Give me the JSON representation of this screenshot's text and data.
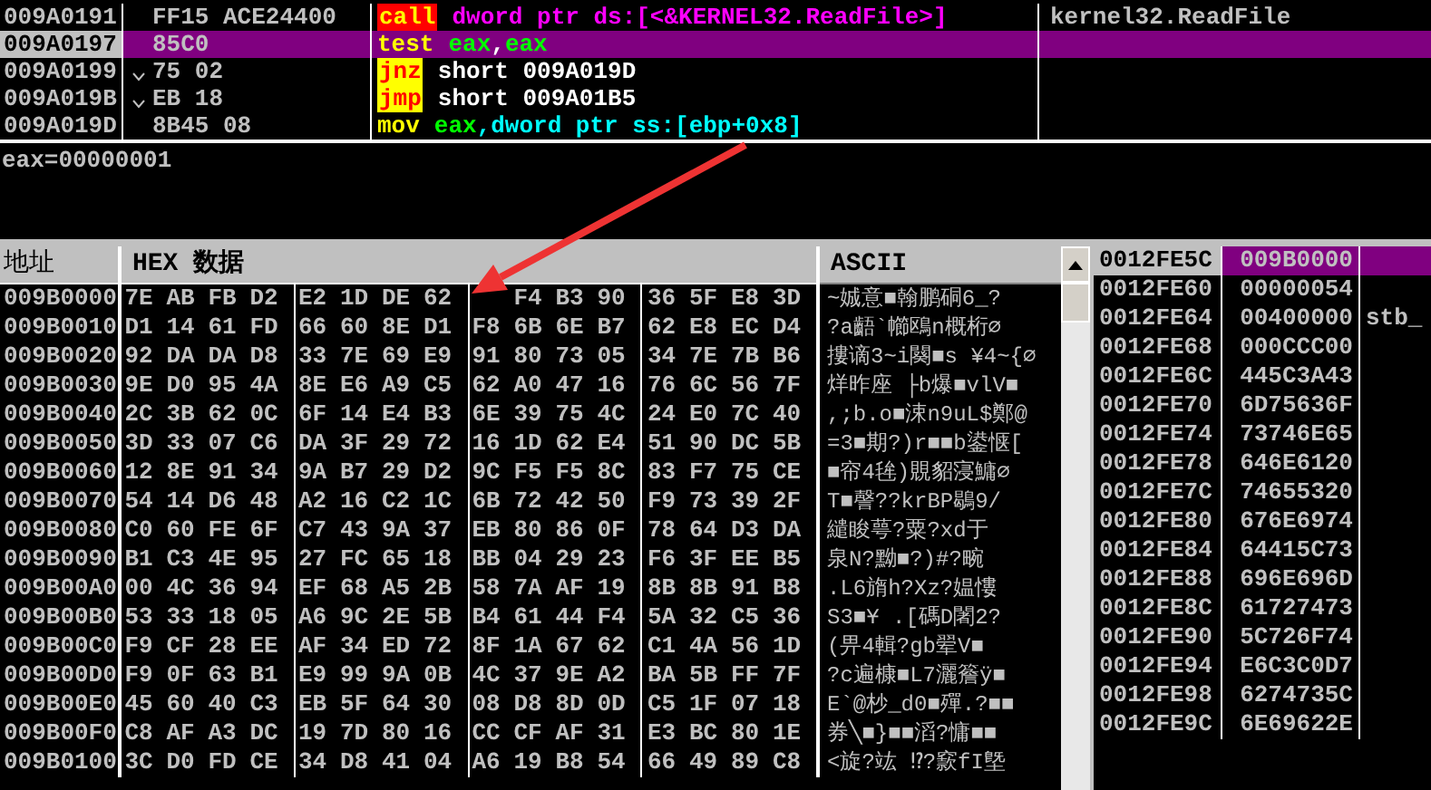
{
  "disassembly": [
    {
      "address": "009A0191",
      "bytes": "FF15 ACE24400",
      "jump": false,
      "selected": false,
      "mnemonic": {
        "text": "call",
        "kind": "call"
      },
      "operands": [
        {
          "text": "dword ptr ds:[<&KERNEL32.ReadFile>]",
          "kind": "target"
        }
      ],
      "comment": "kernel32.ReadFile"
    },
    {
      "address": "009A0197",
      "bytes": "85C0",
      "jump": false,
      "selected": true,
      "mnemonic": {
        "text": "test",
        "kind": "plain"
      },
      "operands": [
        {
          "text": "eax",
          "kind": "register"
        },
        {
          "text": ",",
          "kind": "plain"
        },
        {
          "text": "eax",
          "kind": "register"
        }
      ]
    },
    {
      "address": "009A0199",
      "bytes": "75 02",
      "jump": true,
      "selected": false,
      "mnemonic": {
        "text": "jnz",
        "kind": "jump"
      },
      "operands": [
        {
          "text": "short 009A019D",
          "kind": "plain"
        }
      ]
    },
    {
      "address": "009A019B",
      "bytes": "EB 18",
      "jump": true,
      "selected": false,
      "mnemonic": {
        "text": "jmp",
        "kind": "jump"
      },
      "operands": [
        {
          "text": "short 009A01B5",
          "kind": "plain"
        }
      ]
    },
    {
      "address": "009A019D",
      "bytes": "8B45 08",
      "jump": false,
      "selected": false,
      "mnemonic": {
        "text": "mov",
        "kind": "plain"
      },
      "operands": [
        {
          "text": "eax",
          "kind": "register"
        },
        {
          "text": ",dword ptr ss:[ebp+0x8]",
          "kind": "memory"
        }
      ]
    }
  ],
  "info": "eax=00000001",
  "dump": {
    "columns": [
      "地址",
      "HEX 数据",
      "ASCII"
    ],
    "rows": [
      {
        "address": "009B0000",
        "bytes": [
          "7E",
          "AB",
          "FB",
          "D2",
          "E2",
          "1D",
          "DE",
          "62"
        ],
        "partial_group": [
          "F4",
          "B3",
          "90"
        ],
        "bytes_after": [
          "36",
          "5F",
          "E8",
          "3D"
        ],
        "ascii": "~娍意■翰鹏硐6_?"
      },
      {
        "address": "009B0010",
        "bytes": [
          "D1",
          "14",
          "61",
          "FD",
          "66",
          "60",
          "8E",
          "D1",
          "F8",
          "6B",
          "6E",
          "B7",
          "62",
          "E8",
          "EC",
          "D4"
        ],
        "ascii": "?a齬`幯鴎n概桁∅"
      },
      {
        "address": "009B0020",
        "bytes": [
          "92",
          "DA",
          "DA",
          "D8",
          "33",
          "7E",
          "69",
          "E9",
          "91",
          "80",
          "73",
          "05",
          "34",
          "7E",
          "7B",
          "B6"
        ],
        "ascii": "摟谪3~i闋■s ¥4~{∅"
      },
      {
        "address": "009B0030",
        "bytes": [
          "9E",
          "D0",
          "95",
          "4A",
          "8E",
          "E6",
          "A9",
          "C5",
          "62",
          "A0",
          "47",
          "16",
          "76",
          "6C",
          "56",
          "7F"
        ],
        "ascii": "烊昨座 ├b爆■vlV■"
      },
      {
        "address": "009B0040",
        "bytes": [
          "2C",
          "3B",
          "62",
          "0C",
          "6F",
          "14",
          "E4",
          "B3",
          "6E",
          "39",
          "75",
          "4C",
          "24",
          "E0",
          "7C",
          "40"
        ],
        "ascii": ",;b.o■涑n9uL$鄭@"
      },
      {
        "address": "009B0050",
        "bytes": [
          "3D",
          "33",
          "07",
          "C6",
          "DA",
          "3F",
          "29",
          "72",
          "16",
          "1D",
          "62",
          "E4",
          "51",
          "90",
          "DC",
          "5B"
        ],
        "ascii": "=3■期?)r■■b鍙惬["
      },
      {
        "address": "009B0060",
        "bytes": [
          "12",
          "8E",
          "91",
          "34",
          "9A",
          "B7",
          "29",
          "D2",
          "9C",
          "F5",
          "F5",
          "8C",
          "83",
          "F7",
          "75",
          "CE"
        ],
        "ascii": "■帘4毪)覞貂寖鱅∅"
      },
      {
        "address": "009B0070",
        "bytes": [
          "54",
          "14",
          "D6",
          "48",
          "A2",
          "16",
          "C2",
          "1C",
          "6B",
          "72",
          "42",
          "50",
          "F9",
          "73",
          "39",
          "2F"
        ],
        "ascii": "T■謦??krBP鶡9/"
      },
      {
        "address": "009B0080",
        "bytes": [
          "C0",
          "60",
          "FE",
          "6F",
          "C7",
          "43",
          "9A",
          "37",
          "EB",
          "80",
          "86",
          "0F",
          "78",
          "64",
          "D3",
          "DA"
        ],
        "ascii": "繾睃萼?粟?xd于"
      },
      {
        "address": "009B0090",
        "bytes": [
          "B1",
          "C3",
          "4E",
          "95",
          "27",
          "FC",
          "65",
          "18",
          "BB",
          "04",
          "29",
          "23",
          "F6",
          "3F",
          "EE",
          "B5"
        ],
        "ascii": "泉N?黝■?)#?畹"
      },
      {
        "address": "009B00A0",
        "bytes": [
          "00",
          "4C",
          "36",
          "94",
          "EF",
          "68",
          "A5",
          "2B",
          "58",
          "7A",
          "AF",
          "19",
          "8B",
          "8B",
          "91",
          "B8"
        ],
        "ascii": ".L6旓h?Xz?媪慺"
      },
      {
        "address": "009B00B0",
        "bytes": [
          "53",
          "33",
          "18",
          "05",
          "A6",
          "9C",
          "2E",
          "5B",
          "B4",
          "61",
          "44",
          "F4",
          "5A",
          "32",
          "C5",
          "36"
        ],
        "ascii": "S3■Ұ .[碼D闍2?"
      },
      {
        "address": "009B00C0",
        "bytes": [
          "F9",
          "CF",
          "28",
          "EE",
          "AF",
          "34",
          "ED",
          "72",
          "8F",
          "1A",
          "67",
          "62",
          "C1",
          "4A",
          "56",
          "1D"
        ],
        "ascii": "(畀4輯?gb翚V■"
      },
      {
        "address": "009B00D0",
        "bytes": [
          "F9",
          "0F",
          "63",
          "B1",
          "E9",
          "99",
          "9A",
          "0B",
          "4C",
          "37",
          "9E",
          "A2",
          "BA",
          "5B",
          "FF",
          "7F"
        ],
        "ascii": "?c遍槺■L7灑簷ÿ■"
      },
      {
        "address": "009B00E0",
        "bytes": [
          "45",
          "60",
          "40",
          "C3",
          "EB",
          "5F",
          "64",
          "30",
          "08",
          "D8",
          "8D",
          "0D",
          "C5",
          "1F",
          "07",
          "18"
        ],
        "ascii": "E`@杪_d0■殫.?■■"
      },
      {
        "address": "009B00F0",
        "bytes": [
          "C8",
          "AF",
          "A3",
          "DC",
          "19",
          "7D",
          "80",
          "16",
          "CC",
          "CF",
          "AF",
          "31",
          "E3",
          "BC",
          "80",
          "1E"
        ],
        "ascii": "券╲■}■■滔?慵■■"
      },
      {
        "address": "009B0100",
        "bytes": [
          "3C",
          "D0",
          "FD",
          "CE",
          "34",
          "D8",
          "41",
          "04",
          "A6",
          "19",
          "B8",
          "54",
          "66",
          "49",
          "89",
          "C8"
        ],
        "ascii": "<旋?竑 ⁉?窾fI墍"
      }
    ]
  },
  "stack": [
    {
      "address": "0012FE5C",
      "value": "009B0000",
      "selected": true
    },
    {
      "address": "0012FE60",
      "value": "00000054",
      "selected": false
    },
    {
      "address": "0012FE64",
      "value": "00400000",
      "selected": false,
      "comment": "stb_"
    },
    {
      "address": "0012FE68",
      "value": "000CCC00",
      "selected": false
    },
    {
      "address": "0012FE6C",
      "value": "445C3A43",
      "selected": false
    },
    {
      "address": "0012FE70",
      "value": "6D75636F",
      "selected": false
    },
    {
      "address": "0012FE74",
      "value": "73746E65",
      "selected": false
    },
    {
      "address": "0012FE78",
      "value": "646E6120",
      "selected": false
    },
    {
      "address": "0012FE7C",
      "value": "74655320",
      "selected": false
    },
    {
      "address": "0012FE80",
      "value": "676E6974",
      "selected": false
    },
    {
      "address": "0012FE84",
      "value": "64415C73",
      "selected": false
    },
    {
      "address": "0012FE88",
      "value": "696E696D",
      "selected": false
    },
    {
      "address": "0012FE8C",
      "value": "61727473",
      "selected": false
    },
    {
      "address": "0012FE90",
      "value": "5C726F74",
      "selected": false
    },
    {
      "address": "0012FE94",
      "value": "E6C3C0D7",
      "selected": false
    },
    {
      "address": "0012FE98",
      "value": "6274735C",
      "selected": false
    },
    {
      "address": "0012FE9C",
      "value": "6E69622E",
      "selected": false
    }
  ],
  "annotations": [
    {
      "kind": "arrow"
    }
  ]
}
